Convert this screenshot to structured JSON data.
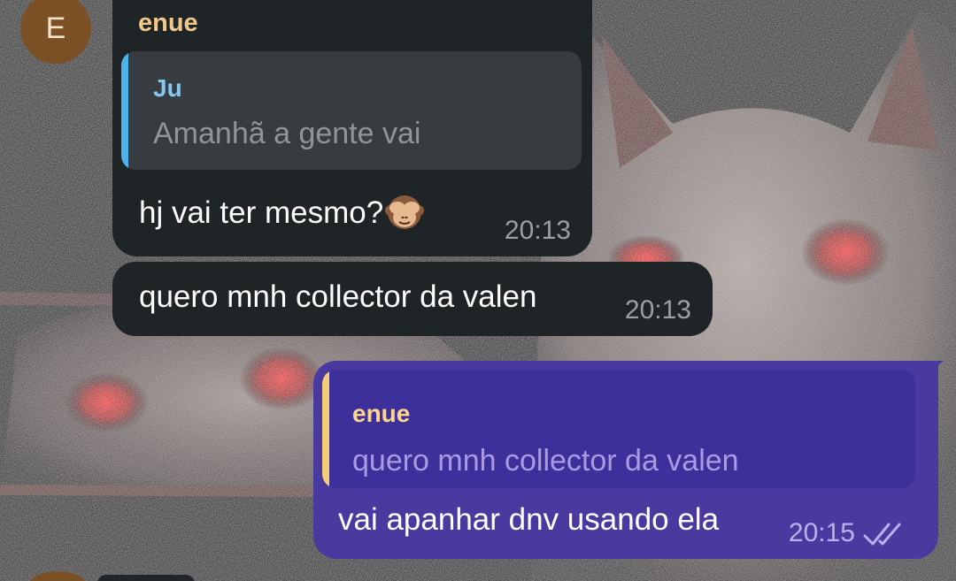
{
  "chat": {
    "messages": [
      {
        "sender": "enue",
        "avatar_letter": "E",
        "reply_to": {
          "name": "Ju",
          "text": "Amanhã a gente vai"
        },
        "text": "hj vai ter mesmo?",
        "emoji": "see-no-evil-monkey-icon",
        "time": "20:13",
        "direction": "incoming"
      },
      {
        "text": "quero mnh collector da valen",
        "time": "20:13",
        "direction": "incoming"
      },
      {
        "reply_to": {
          "name": "enue",
          "text": "quero mnh collector da valen"
        },
        "text": "vai apanhar dnv usando ela",
        "time": "20:15",
        "status": "read",
        "direction": "outgoing"
      }
    ]
  },
  "colors": {
    "incoming_bubble": "#1f2427",
    "outgoing_bubble": "#4a3aa0",
    "sender_name": "#f2c78a",
    "reply_bar_incoming": "#4fb1ea",
    "reply_bar_outgoing": "#f5cf77",
    "avatar": "#7a5024"
  },
  "background": {
    "icon": "cat-wallpaper"
  }
}
